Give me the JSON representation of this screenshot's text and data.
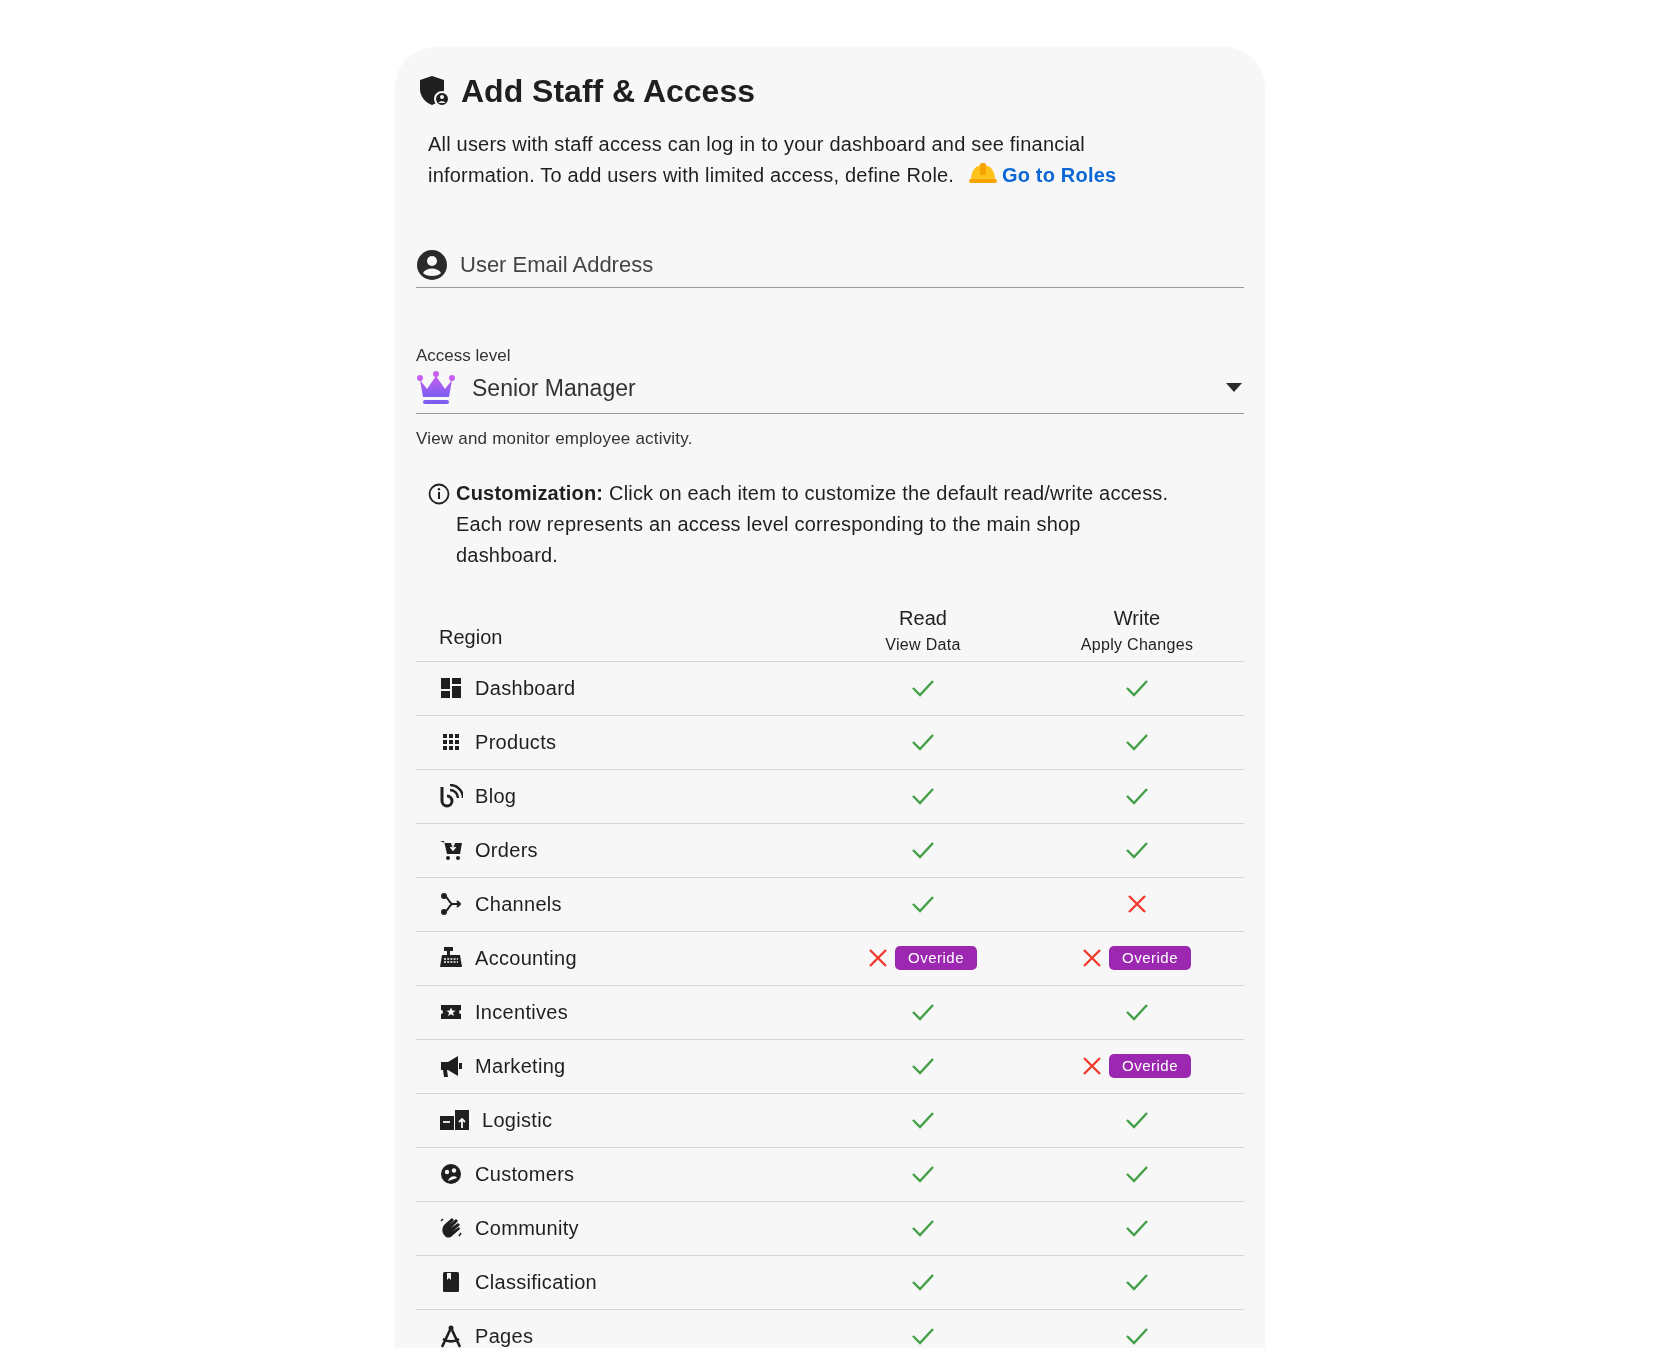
{
  "title": "Add Staff & Access",
  "intro": {
    "text": "All users with staff access can log in to your dashboard and see financial information. To add users with limited access, define Role.",
    "link": "Go to Roles"
  },
  "email_field": {
    "placeholder": "User Email Address"
  },
  "access_level": {
    "label": "Access level",
    "value": "Senior Manager",
    "helper": "View and monitor employee activity."
  },
  "note": "**Customization:** Click on each item to customize the default read/write access. Each row represents an access level corresponding to the main shop dashboard.",
  "table": {
    "columns": [
      {
        "title": "Region"
      },
      {
        "title": "Read",
        "subtitle": "View Data"
      },
      {
        "title": "Write",
        "subtitle": "Apply Changes"
      }
    ],
    "rows": [
      {
        "region": "Dashboard",
        "read": {
          "granted": true
        },
        "write": {
          "granted": true
        }
      },
      {
        "region": "Products",
        "read": {
          "granted": true
        },
        "write": {
          "granted": true
        }
      },
      {
        "region": "Blog",
        "read": {
          "granted": true
        },
        "write": {
          "granted": true
        }
      },
      {
        "region": "Orders",
        "read": {
          "granted": true
        },
        "write": {
          "granted": true
        }
      },
      {
        "region": "Channels",
        "read": {
          "granted": true
        },
        "write": {
          "granted": false
        }
      },
      {
        "region": "Accounting",
        "read": {
          "granted": false,
          "badge": "Overide"
        },
        "write": {
          "granted": false,
          "badge": "Overide"
        }
      },
      {
        "region": "Incentives",
        "read": {
          "granted": true
        },
        "write": {
          "granted": true
        }
      },
      {
        "region": "Marketing",
        "read": {
          "granted": true
        },
        "write": {
          "granted": false,
          "badge": "Overide"
        }
      },
      {
        "region": "Logistic",
        "read": {
          "granted": true
        },
        "write": {
          "granted": true
        }
      },
      {
        "region": "Customers",
        "read": {
          "granted": true
        },
        "write": {
          "granted": true
        }
      },
      {
        "region": "Community",
        "read": {
          "granted": true
        },
        "write": {
          "granted": true
        }
      },
      {
        "region": "Classification",
        "read": {
          "granted": true
        },
        "write": {
          "granted": true
        }
      },
      {
        "region": "Pages",
        "read": {
          "granted": true
        },
        "write": {
          "granted": true
        }
      }
    ]
  }
}
